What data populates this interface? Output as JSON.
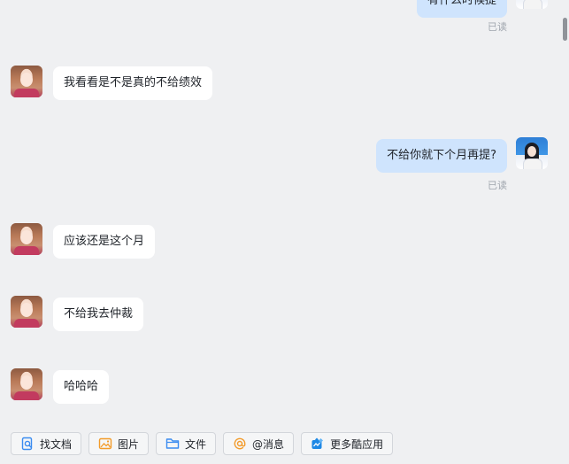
{
  "messages": [
    {
      "side": "right",
      "text": "有什么时候提",
      "read": "已读"
    },
    {
      "side": "left",
      "text": "我看看是不是真的不给绩效"
    },
    {
      "side": "right",
      "text": "不给你就下个月再提?",
      "read": "已读"
    },
    {
      "side": "left",
      "text": "应该还是这个月"
    },
    {
      "side": "left",
      "text": "不给我去仲裁"
    },
    {
      "side": "left",
      "text": "哈哈哈"
    }
  ],
  "toolbar": {
    "find_doc": "找文档",
    "image": "图片",
    "file": "文件",
    "mention": "@消息",
    "more_apps": "更多酷应用"
  },
  "colors": {
    "my_bubble": "#cfe4fd",
    "other_bubble": "#ffffff",
    "background": "#eff0f2",
    "accent_blue": "#3b8cf0",
    "accent_orange": "#f39b2a"
  }
}
